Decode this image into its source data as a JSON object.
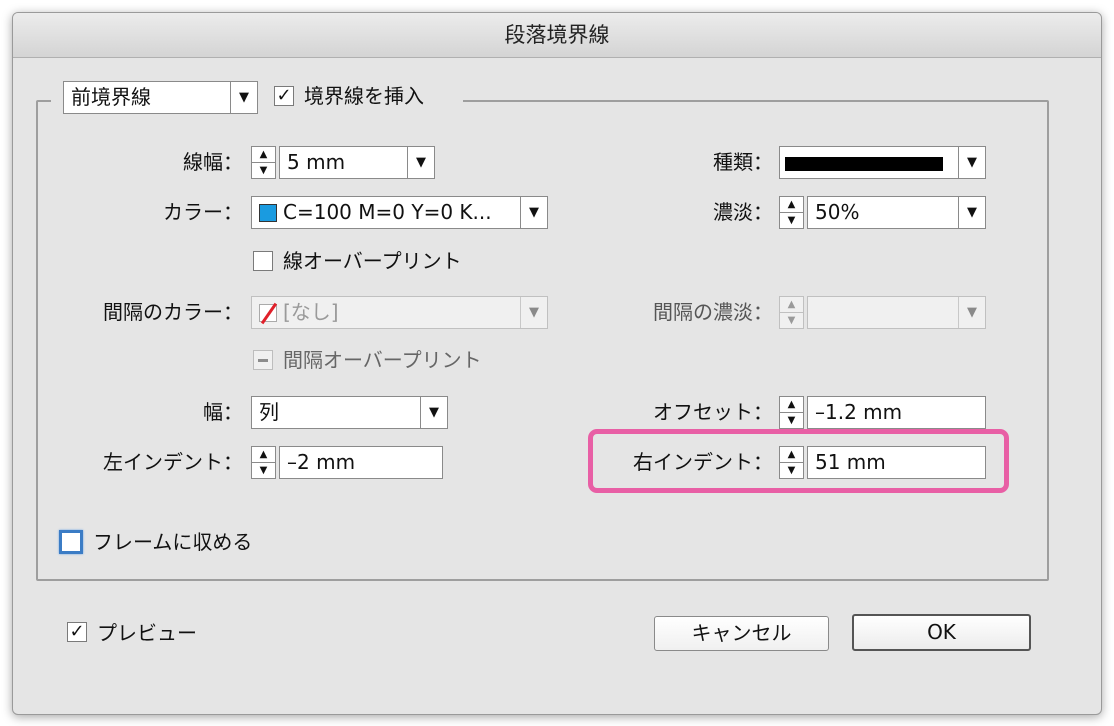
{
  "dialog": {
    "title": "段落境界線"
  },
  "border_type": {
    "selected": "前境界線"
  },
  "insert_border": {
    "label": "境界線を挿入",
    "checked": true
  },
  "left_col": {
    "stroke_weight": {
      "label": "線幅：",
      "value": "5 mm"
    },
    "color": {
      "label": "カラー：",
      "value": "C=100 M=0 Y=0 K..."
    },
    "overprint_stroke": {
      "label": "線オーバープリント"
    },
    "gap_color": {
      "label": "間隔のカラー：",
      "value": "[なし]"
    },
    "overprint_gap": {
      "label": "間隔オーバープリント"
    },
    "width": {
      "label": "幅：",
      "value": "列"
    },
    "left_indent": {
      "label": "左インデント：",
      "value": "–2 mm"
    }
  },
  "right_col": {
    "type": {
      "label": "種類："
    },
    "tint": {
      "label": "濃淡：",
      "value": "50%"
    },
    "gap_tint": {
      "label": "間隔の濃淡：",
      "value": ""
    },
    "offset": {
      "label": "オフセット：",
      "value": "–1.2 mm"
    },
    "right_indent": {
      "label": "右インデント：",
      "value": "51 mm"
    }
  },
  "fit_to_frame": {
    "label": "フレームに収める"
  },
  "preview": {
    "label": "プレビュー",
    "checked": true
  },
  "buttons": {
    "cancel": "キャンセル",
    "ok": "OK"
  },
  "colors": {
    "highlight": "#e85fa5",
    "swatch": "#1a9be0",
    "focus": "#3b7cc5"
  }
}
